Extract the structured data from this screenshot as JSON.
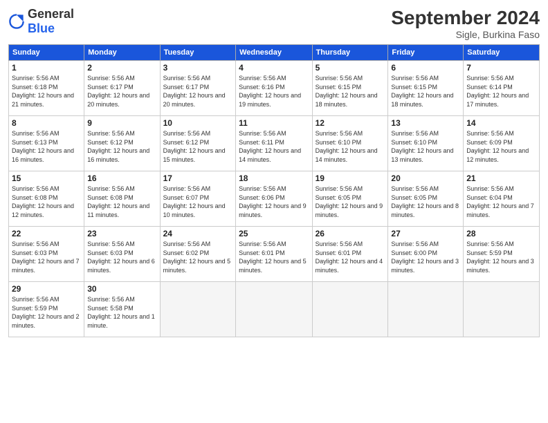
{
  "header": {
    "logo_general": "General",
    "logo_blue": "Blue",
    "month_year": "September 2024",
    "location": "Sigle, Burkina Faso"
  },
  "weekdays": [
    "Sunday",
    "Monday",
    "Tuesday",
    "Wednesday",
    "Thursday",
    "Friday",
    "Saturday"
  ],
  "weeks": [
    [
      {
        "day": "1",
        "sunrise": "Sunrise: 5:56 AM",
        "sunset": "Sunset: 6:18 PM",
        "daylight": "Daylight: 12 hours and 21 minutes."
      },
      {
        "day": "2",
        "sunrise": "Sunrise: 5:56 AM",
        "sunset": "Sunset: 6:17 PM",
        "daylight": "Daylight: 12 hours and 20 minutes."
      },
      {
        "day": "3",
        "sunrise": "Sunrise: 5:56 AM",
        "sunset": "Sunset: 6:17 PM",
        "daylight": "Daylight: 12 hours and 20 minutes."
      },
      {
        "day": "4",
        "sunrise": "Sunrise: 5:56 AM",
        "sunset": "Sunset: 6:16 PM",
        "daylight": "Daylight: 12 hours and 19 minutes."
      },
      {
        "day": "5",
        "sunrise": "Sunrise: 5:56 AM",
        "sunset": "Sunset: 6:15 PM",
        "daylight": "Daylight: 12 hours and 18 minutes."
      },
      {
        "day": "6",
        "sunrise": "Sunrise: 5:56 AM",
        "sunset": "Sunset: 6:15 PM",
        "daylight": "Daylight: 12 hours and 18 minutes."
      },
      {
        "day": "7",
        "sunrise": "Sunrise: 5:56 AM",
        "sunset": "Sunset: 6:14 PM",
        "daylight": "Daylight: 12 hours and 17 minutes."
      }
    ],
    [
      {
        "day": "8",
        "sunrise": "Sunrise: 5:56 AM",
        "sunset": "Sunset: 6:13 PM",
        "daylight": "Daylight: 12 hours and 16 minutes."
      },
      {
        "day": "9",
        "sunrise": "Sunrise: 5:56 AM",
        "sunset": "Sunset: 6:12 PM",
        "daylight": "Daylight: 12 hours and 16 minutes."
      },
      {
        "day": "10",
        "sunrise": "Sunrise: 5:56 AM",
        "sunset": "Sunset: 6:12 PM",
        "daylight": "Daylight: 12 hours and 15 minutes."
      },
      {
        "day": "11",
        "sunrise": "Sunrise: 5:56 AM",
        "sunset": "Sunset: 6:11 PM",
        "daylight": "Daylight: 12 hours and 14 minutes."
      },
      {
        "day": "12",
        "sunrise": "Sunrise: 5:56 AM",
        "sunset": "Sunset: 6:10 PM",
        "daylight": "Daylight: 12 hours and 14 minutes."
      },
      {
        "day": "13",
        "sunrise": "Sunrise: 5:56 AM",
        "sunset": "Sunset: 6:10 PM",
        "daylight": "Daylight: 12 hours and 13 minutes."
      },
      {
        "day": "14",
        "sunrise": "Sunrise: 5:56 AM",
        "sunset": "Sunset: 6:09 PM",
        "daylight": "Daylight: 12 hours and 12 minutes."
      }
    ],
    [
      {
        "day": "15",
        "sunrise": "Sunrise: 5:56 AM",
        "sunset": "Sunset: 6:08 PM",
        "daylight": "Daylight: 12 hours and 12 minutes."
      },
      {
        "day": "16",
        "sunrise": "Sunrise: 5:56 AM",
        "sunset": "Sunset: 6:08 PM",
        "daylight": "Daylight: 12 hours and 11 minutes."
      },
      {
        "day": "17",
        "sunrise": "Sunrise: 5:56 AM",
        "sunset": "Sunset: 6:07 PM",
        "daylight": "Daylight: 12 hours and 10 minutes."
      },
      {
        "day": "18",
        "sunrise": "Sunrise: 5:56 AM",
        "sunset": "Sunset: 6:06 PM",
        "daylight": "Daylight: 12 hours and 9 minutes."
      },
      {
        "day": "19",
        "sunrise": "Sunrise: 5:56 AM",
        "sunset": "Sunset: 6:05 PM",
        "daylight": "Daylight: 12 hours and 9 minutes."
      },
      {
        "day": "20",
        "sunrise": "Sunrise: 5:56 AM",
        "sunset": "Sunset: 6:05 PM",
        "daylight": "Daylight: 12 hours and 8 minutes."
      },
      {
        "day": "21",
        "sunrise": "Sunrise: 5:56 AM",
        "sunset": "Sunset: 6:04 PM",
        "daylight": "Daylight: 12 hours and 7 minutes."
      }
    ],
    [
      {
        "day": "22",
        "sunrise": "Sunrise: 5:56 AM",
        "sunset": "Sunset: 6:03 PM",
        "daylight": "Daylight: 12 hours and 7 minutes."
      },
      {
        "day": "23",
        "sunrise": "Sunrise: 5:56 AM",
        "sunset": "Sunset: 6:03 PM",
        "daylight": "Daylight: 12 hours and 6 minutes."
      },
      {
        "day": "24",
        "sunrise": "Sunrise: 5:56 AM",
        "sunset": "Sunset: 6:02 PM",
        "daylight": "Daylight: 12 hours and 5 minutes."
      },
      {
        "day": "25",
        "sunrise": "Sunrise: 5:56 AM",
        "sunset": "Sunset: 6:01 PM",
        "daylight": "Daylight: 12 hours and 5 minutes."
      },
      {
        "day": "26",
        "sunrise": "Sunrise: 5:56 AM",
        "sunset": "Sunset: 6:01 PM",
        "daylight": "Daylight: 12 hours and 4 minutes."
      },
      {
        "day": "27",
        "sunrise": "Sunrise: 5:56 AM",
        "sunset": "Sunset: 6:00 PM",
        "daylight": "Daylight: 12 hours and 3 minutes."
      },
      {
        "day": "28",
        "sunrise": "Sunrise: 5:56 AM",
        "sunset": "Sunset: 5:59 PM",
        "daylight": "Daylight: 12 hours and 3 minutes."
      }
    ],
    [
      {
        "day": "29",
        "sunrise": "Sunrise: 5:56 AM",
        "sunset": "Sunset: 5:59 PM",
        "daylight": "Daylight: 12 hours and 2 minutes."
      },
      {
        "day": "30",
        "sunrise": "Sunrise: 5:56 AM",
        "sunset": "Sunset: 5:58 PM",
        "daylight": "Daylight: 12 hours and 1 minute."
      },
      null,
      null,
      null,
      null,
      null
    ]
  ]
}
